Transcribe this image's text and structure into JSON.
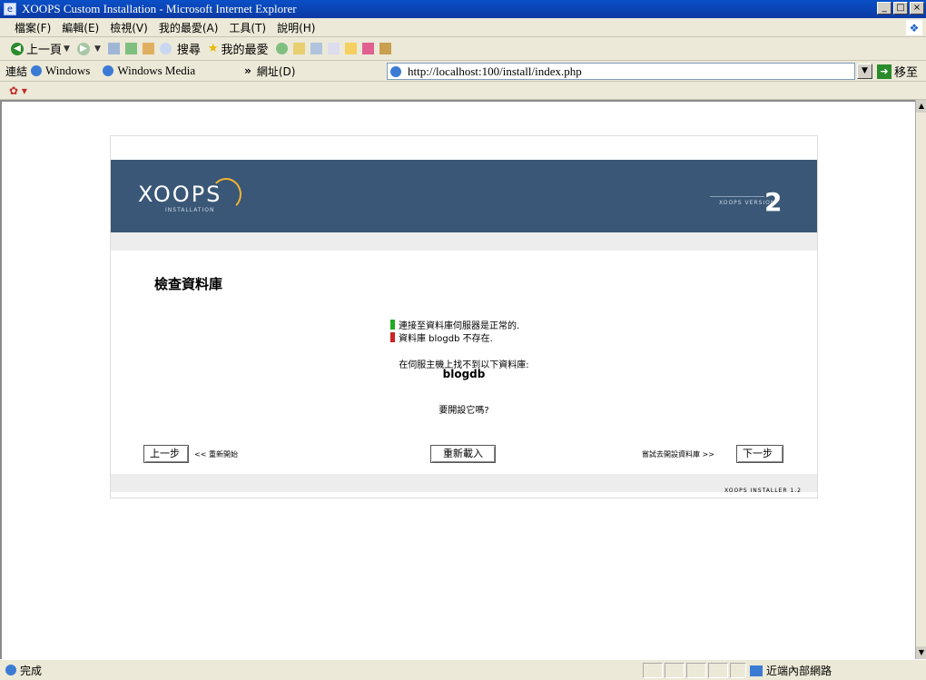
{
  "window": {
    "title": "XOOPS Custom Installation - Microsoft Internet Explorer"
  },
  "menu": [
    "檔案(F)",
    "編輯(E)",
    "檢視(V)",
    "我的最愛(A)",
    "工具(T)",
    "說明(H)"
  ],
  "toolbar": {
    "back_label": "上一頁",
    "search_label": "搜尋",
    "favorites_label": "我的最愛"
  },
  "linksbar": {
    "label": "連結",
    "items": [
      "Windows",
      "Windows Media"
    ]
  },
  "address": {
    "label": "網址(D)",
    "url": "http://localhost:100/install/index.php",
    "go_label": "移至"
  },
  "installer": {
    "logo": "XOOPS",
    "logo_sub": "INSTALLATION",
    "version_label": "XOOPS VERSION",
    "version_number": "2",
    "page_title": "檢查資料庫",
    "status_ok": "連接至資料庫伺服器是正常的.",
    "status_error": "資料庫 blogdb 不存在.",
    "not_found_msg": "在伺服主機上找不到以下資料庫:",
    "db_name": "blogdb",
    "create_prompt": "要開設它嗎?",
    "prev_button": "上一步",
    "prev_hint": "<< 重新開始",
    "reload_button": "重新載入",
    "next_hint": "嘗試去開設資料庫 >>",
    "next_button": "下一步",
    "footer": "XOOPS INSTALLER 1.2",
    "colors": {
      "banner": "#3a5777",
      "ok": "#22aa22",
      "error": "#cc2222"
    }
  },
  "statusbar": {
    "text": "完成",
    "zone": "近端內部網路"
  }
}
